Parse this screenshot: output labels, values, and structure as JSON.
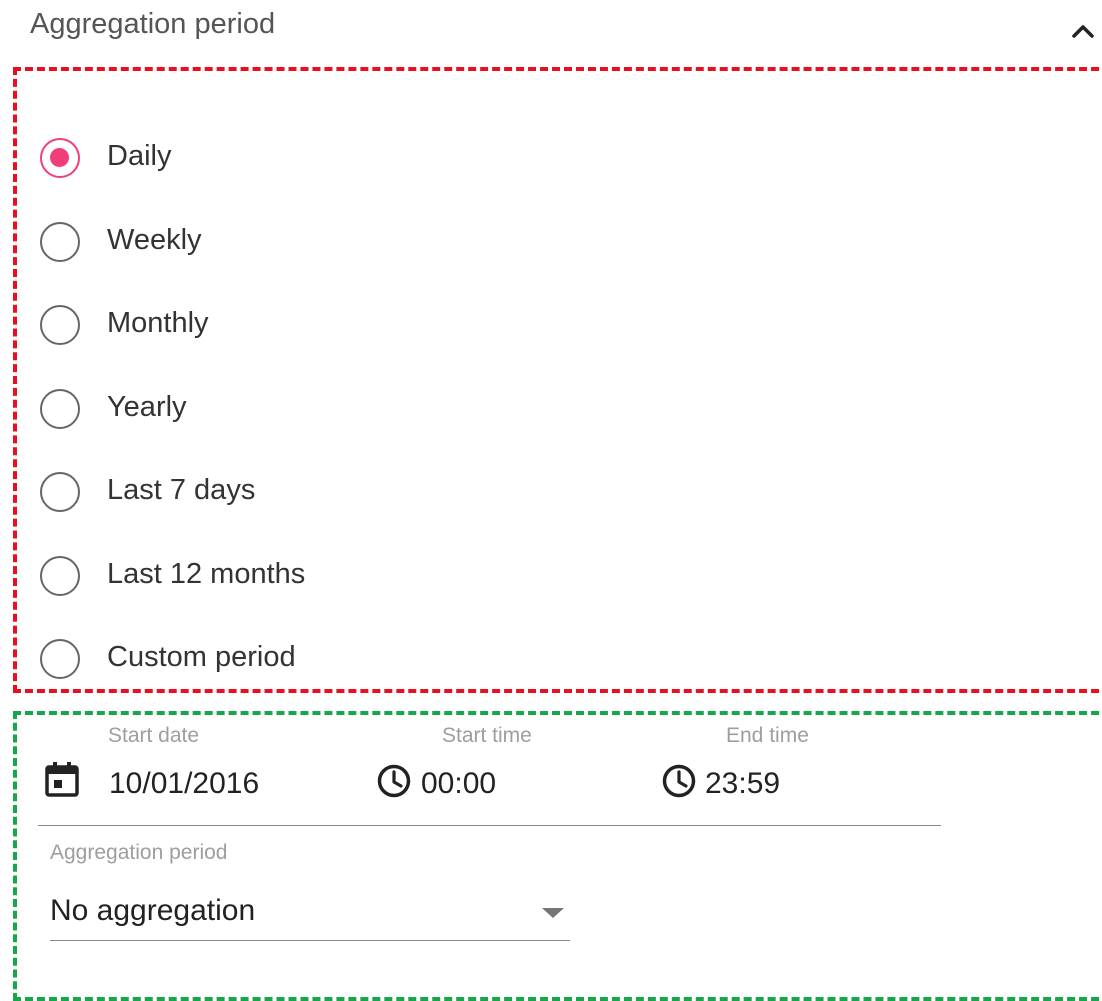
{
  "header": {
    "title": "Aggregation period",
    "collapse_icon": "chevron-up-icon"
  },
  "radio_options": [
    {
      "label": "Daily",
      "checked": true
    },
    {
      "label": "Weekly",
      "checked": false
    },
    {
      "label": "Monthly",
      "checked": false
    },
    {
      "label": "Yearly",
      "checked": false
    },
    {
      "label": "Last 7 days",
      "checked": false
    },
    {
      "label": "Last 12 months",
      "checked": false
    },
    {
      "label": "Custom period",
      "checked": false
    }
  ],
  "custom_period": {
    "start_date": {
      "label": "Start date",
      "value": "10/01/2016",
      "icon": "calendar-icon"
    },
    "start_time": {
      "label": "Start time",
      "value": "00:00",
      "icon": "clock-icon"
    },
    "end_time": {
      "label": "End time",
      "value": "23:59",
      "icon": "clock-icon"
    },
    "aggregation": {
      "label": "Aggregation period",
      "value": "No aggregation",
      "icon": "dropdown-arrow-icon"
    }
  },
  "colors": {
    "accent": "#ef3e7a",
    "red_annotation": "#e8101f",
    "green_annotation": "#14a84a"
  }
}
